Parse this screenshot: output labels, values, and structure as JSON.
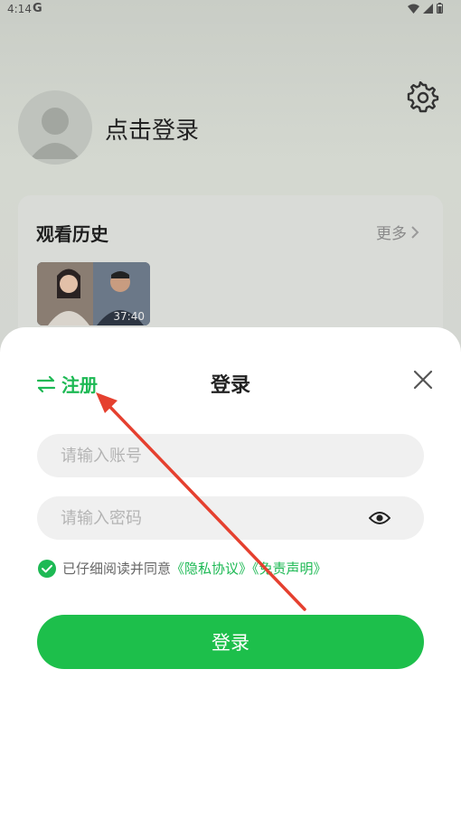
{
  "status_bar": {
    "time": "4:14",
    "g_label": "G"
  },
  "profile": {
    "login_prompt": "点击登录"
  },
  "history": {
    "title": "观看历史",
    "more_label": "更多",
    "items": [
      {
        "duration": "37:40"
      }
    ]
  },
  "login_sheet": {
    "switch_label": "注册",
    "title": "登录",
    "account_placeholder": "请输入账号",
    "password_placeholder": "请输入密码",
    "agree_text": "已仔细阅读并同意",
    "privacy_link": "《隐私协议》",
    "disclaimer_link": "《免责声明》",
    "submit_label": "登录"
  },
  "colors": {
    "accent": "#1dbf4b",
    "annotation_arrow": "#e5402f"
  }
}
